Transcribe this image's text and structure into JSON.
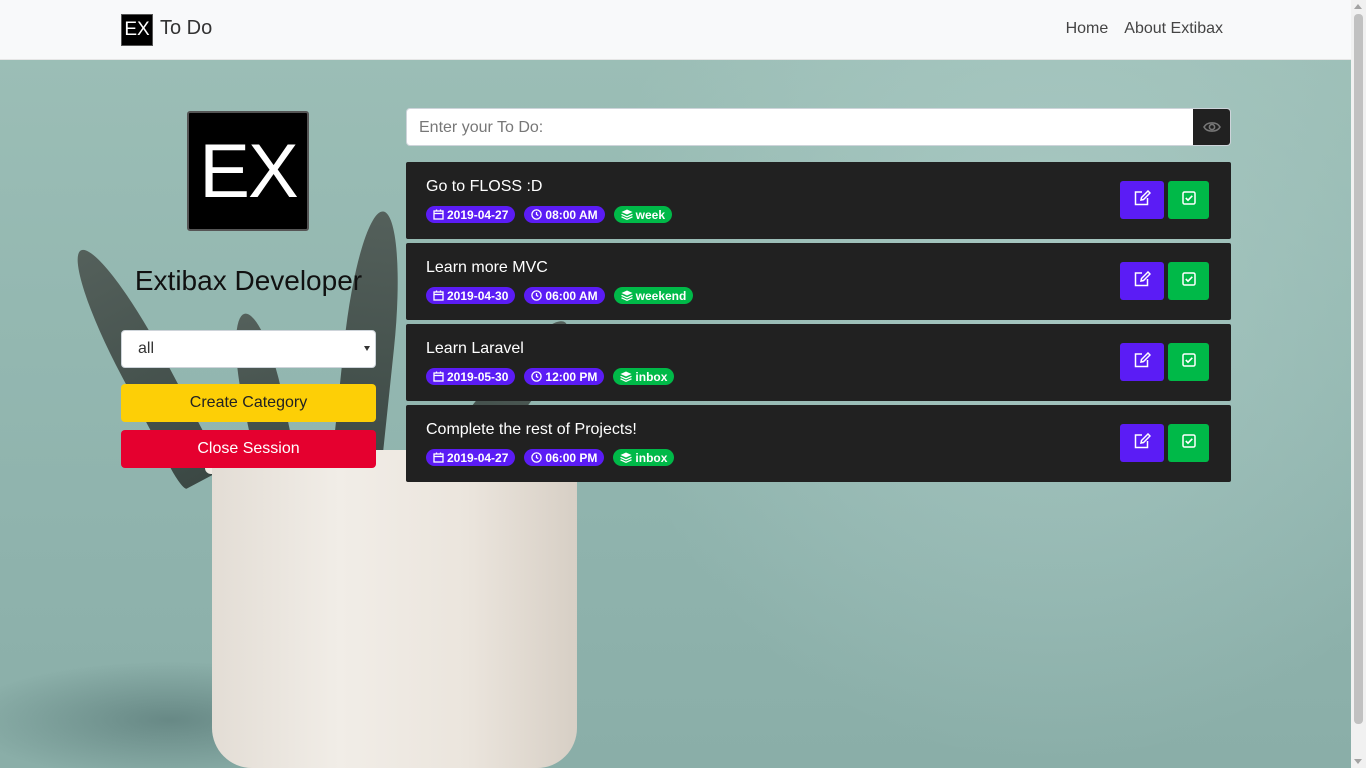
{
  "navbar": {
    "logo_text": "EX",
    "title": "To Do",
    "links": [
      "Home",
      "About Extibax"
    ]
  },
  "sidebar": {
    "logo_text": "EX",
    "name": "Extibax Developer",
    "category_select": {
      "value": "all"
    },
    "create_category_label": "Create Category",
    "close_session_label": "Close Session"
  },
  "main": {
    "input_placeholder": "Enter your To Do:",
    "todos": [
      {
        "title": "Go to FLOSS :D",
        "date": "2019-04-27",
        "time": "08:00 AM",
        "category": "week"
      },
      {
        "title": "Learn more MVC",
        "date": "2019-04-30",
        "time": "06:00 AM",
        "category": "weekend"
      },
      {
        "title": "Learn Laravel",
        "date": "2019-05-30",
        "time": "12:00 PM",
        "category": "inbox"
      },
      {
        "title": "Complete the rest of Projects!",
        "date": "2019-04-27",
        "time": "06:00 PM",
        "category": "inbox"
      }
    ]
  },
  "icons": {
    "eye": "eye-icon",
    "calendar": "calendar-icon",
    "clock": "clock-icon",
    "layers": "layers-icon",
    "edit": "edit-icon",
    "check": "check-square-icon"
  },
  "colors": {
    "navbar_bg": "#f8f9fa",
    "card_bg": "#212121",
    "accent_purple": "#5b1cf5",
    "accent_green": "#00b948",
    "create_btn": "#fdcf06",
    "close_btn": "#e5002f"
  }
}
